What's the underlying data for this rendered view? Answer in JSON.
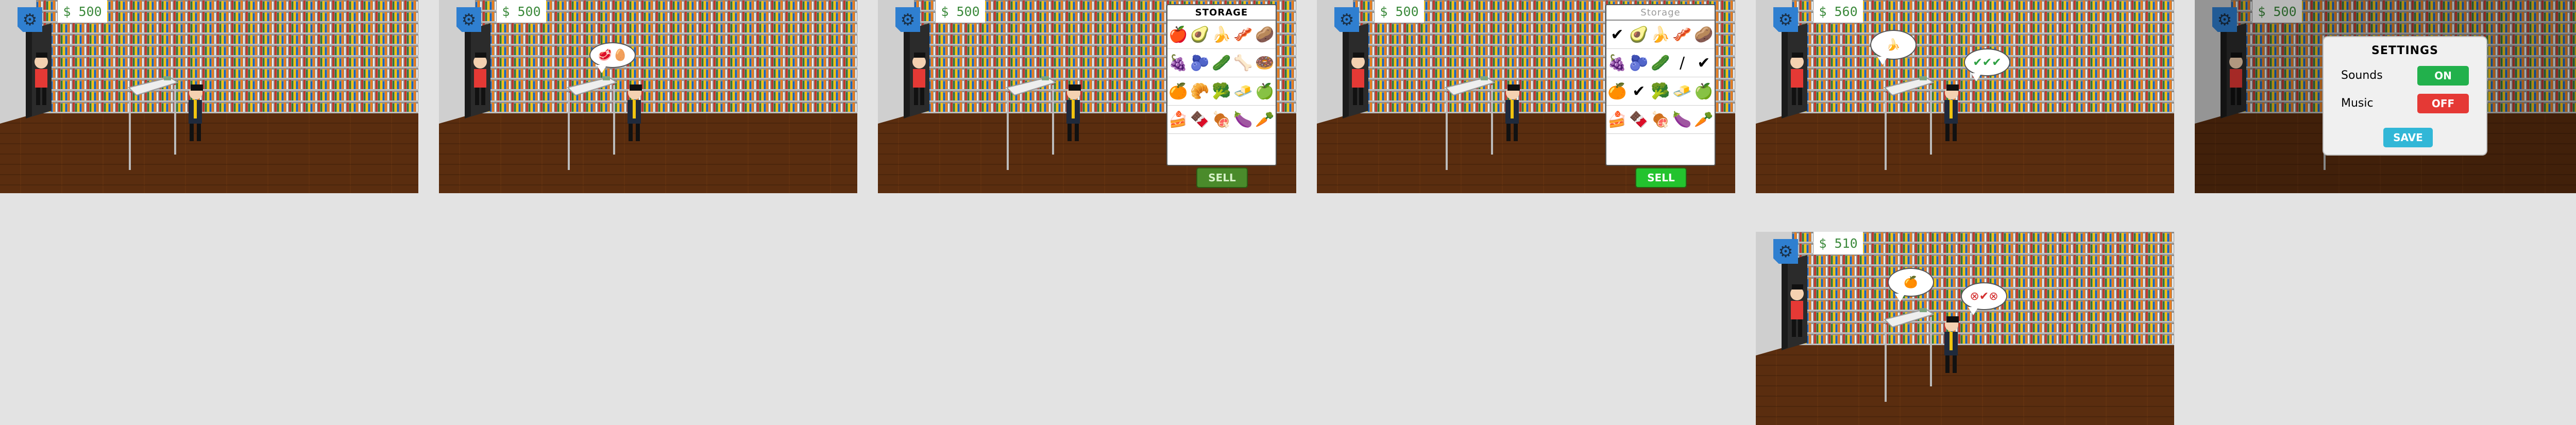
{
  "colors": {
    "background": "#e3e3e3",
    "floor": "#5a2d0f",
    "shelf": "#9a9a9a",
    "money_text": "#3c8a3c",
    "gear_blue": "#2f7fd0",
    "sell_active": "#23c32e",
    "sell_inactive": "#4a8b2b",
    "toggle_on": "#22b14c",
    "toggle_off": "#e53935",
    "save": "#31b7d7"
  },
  "panels": [
    {
      "money": "$ 500"
    },
    {
      "money": "$ 500",
      "customer_request": [
        "🥩",
        "🥚"
      ]
    },
    {
      "money": "$ 500"
    },
    {
      "money": "$ 500"
    },
    {
      "money": "$ 560",
      "customer_request": [
        "🍌"
      ],
      "result": "✔✔✔"
    },
    {
      "money": "$ 500"
    },
    {
      "money": "$ 510",
      "customer_request": [
        "🍊"
      ],
      "result": "⊗✔⊗"
    }
  ],
  "storage_open": {
    "title": "STORAGE",
    "items": [
      "🍎",
      "🥑",
      "🍌",
      "🥓",
      "🥔",
      "🍇",
      "🫐",
      "🥒",
      "🦴",
      "🍩",
      "🍊",
      "🥐",
      "🥦",
      "🧈",
      "🍏",
      "🍰",
      "🍫",
      "🍖",
      "🍆",
      "🥕"
    ],
    "sell_label": "SELL"
  },
  "storage_selected": {
    "title": "Storage",
    "items": [
      "✔",
      "🥑",
      "🍌",
      "🥓",
      "🥔",
      "🍇",
      "🫐",
      "🥒",
      "/",
      "✔",
      "🍊",
      "✔",
      "🥦",
      "🧈",
      "🍏",
      "🍰",
      "🍫",
      "🍖",
      "🍆",
      "🥕"
    ],
    "sell_label": "SELL"
  },
  "settings": {
    "title": "SETTINGS",
    "sounds_label": "Sounds",
    "sounds_value": "ON",
    "music_label": "Music",
    "music_value": "OFF",
    "save_label": "SAVE"
  },
  "icons": {
    "gear": "gear-icon"
  }
}
